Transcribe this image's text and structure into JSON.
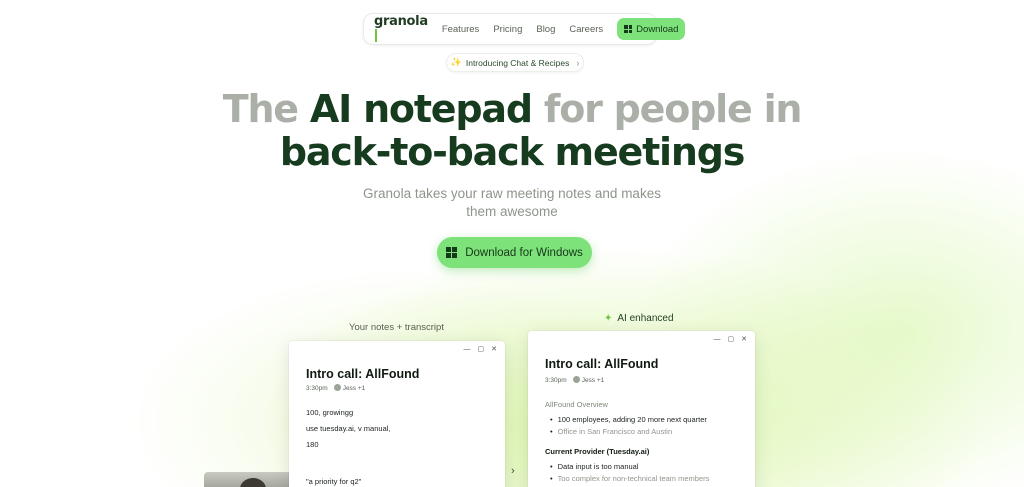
{
  "nav": {
    "logo": "granola",
    "links": [
      "Features",
      "Pricing",
      "Blog",
      "Careers"
    ],
    "download_label": "Download"
  },
  "announcement": {
    "label": "Introducing Chat & Recipes"
  },
  "hero": {
    "headline_part1": "The ",
    "headline_part2": "AI notepad",
    "headline_part3": " for people in",
    "headline_line2": "back-to-back meetings",
    "subheadline": "Granola takes your raw meeting notes and makes them awesome",
    "cta_label": "Download for Windows"
  },
  "demo": {
    "left_caption": "Your notes + transcript",
    "right_caption": "AI enhanced",
    "left_card": {
      "title": "Intro call: AllFound",
      "time": "3:30pm",
      "attendees": "Jess +1",
      "lines": [
        "100, growingg",
        "use tuesday.ai, v manual,",
        "180",
        "",
        "\"a priority for q2\""
      ]
    },
    "right_card": {
      "title": "Intro call: AllFound",
      "time": "3:30pm",
      "attendees": "Jess +1",
      "section1_title": "AllFound Overview",
      "section1_bullets": [
        {
          "text": "100 employees, adding 20 more next quarter",
          "muted": false
        },
        {
          "text": "Office in San Francisco and Austin",
          "muted": true
        }
      ],
      "section2_title": "Current Provider (Tuesday.ai)",
      "section2_bullets": [
        {
          "text": "Data input is too manual",
          "muted": false
        },
        {
          "text": "Too complex for non-technical team members",
          "muted": true
        }
      ]
    }
  },
  "colors": {
    "accent": "#7ee27a",
    "brand_dark": "#163b1e",
    "muted_text": "#aab0a8"
  }
}
